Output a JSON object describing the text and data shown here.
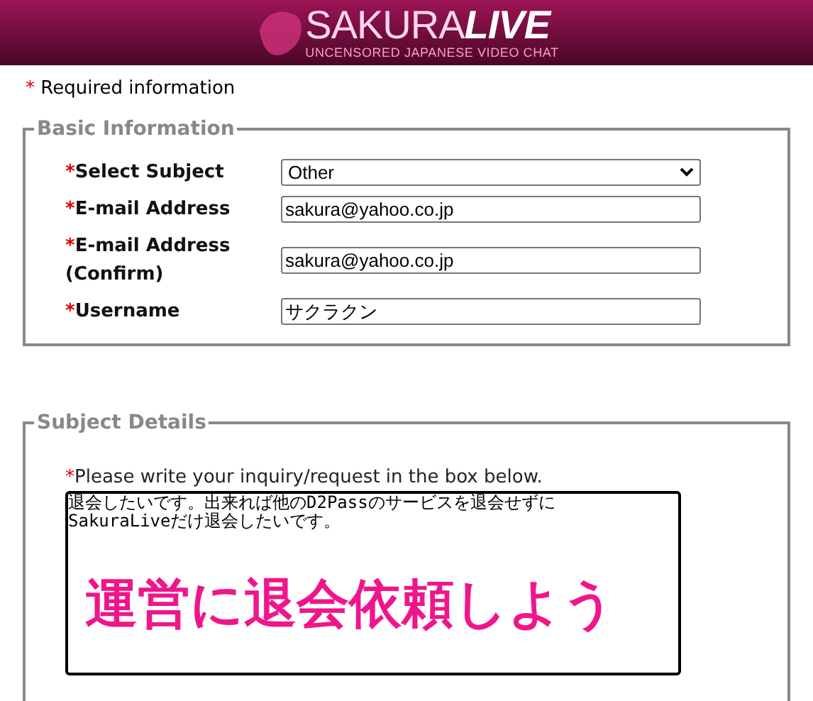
{
  "header": {
    "logo_light": "SAKURA",
    "logo_bold": "LIVE",
    "tagline": "UNCENSORED JAPANESE VIDEO CHAT"
  },
  "required_note": {
    "mark": "*",
    "text": "Required information"
  },
  "basic_information": {
    "legend": "Basic Information",
    "fields": [
      {
        "kind": "select",
        "mark": "*",
        "label": "Select Subject",
        "value": "Other"
      },
      {
        "kind": "text",
        "mark": "*",
        "label": "E-mail Address",
        "value": "sakura@yahoo.co.jp"
      },
      {
        "kind": "text",
        "mark": "*",
        "label": "E-mail Address (Confirm)",
        "value": "sakura@yahoo.co.jp"
      },
      {
        "kind": "text",
        "mark": "*",
        "label": "Username",
        "value": "サクラクン"
      }
    ]
  },
  "subject_details": {
    "legend": "Subject Details",
    "mark": "*",
    "instruction": "Please write your inquiry/request in the box below.",
    "message": "退会したいです。出来れば他のD2Passのサービスを退会せずに\nSakuraLiveだけ退会したいです。",
    "annotation": "運営に退会依頼しよう"
  }
}
